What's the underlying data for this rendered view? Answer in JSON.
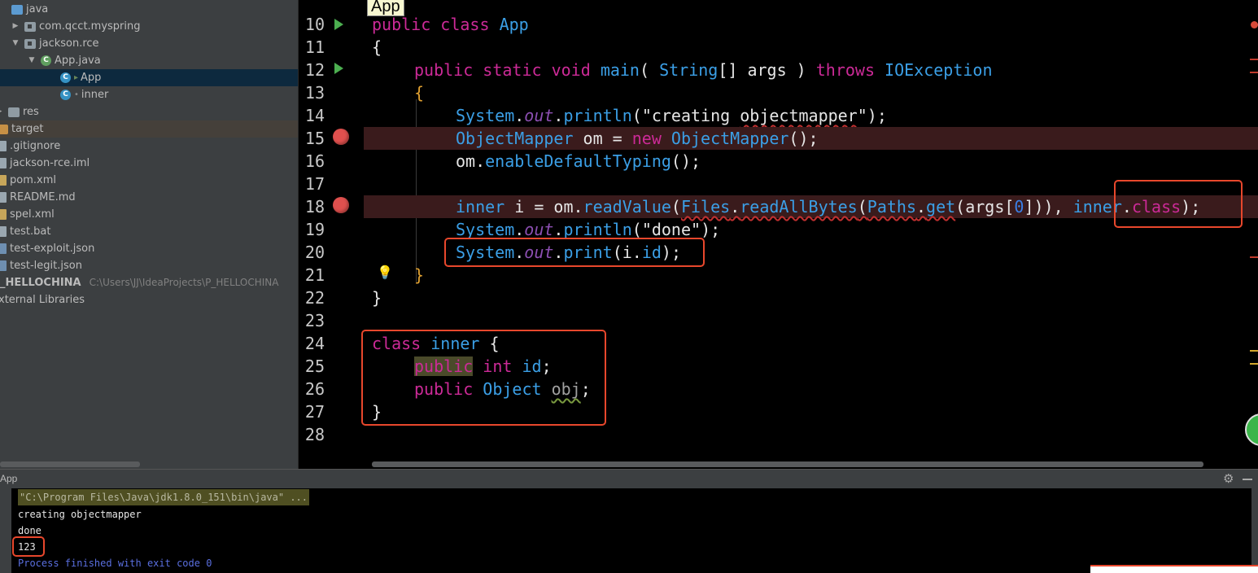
{
  "project_tree": [
    {
      "label": "java",
      "icon": "folder-blue-icon",
      "indent": 0
    },
    {
      "label": "com.qcct.myspring",
      "icon": "package-icon",
      "arrow": "▶"
    },
    {
      "label": "jackson.rce",
      "icon": "package-icon",
      "arrow": "▼"
    },
    {
      "label": "App.java",
      "icon": "java-file-icon",
      "arrow": "▼"
    },
    {
      "label": "App",
      "icon": "class-icon",
      "selected": true
    },
    {
      "label": "inner",
      "icon": "class-icon"
    },
    {
      "label": "res",
      "icon": "folder-icon",
      "arrow": "▶"
    },
    {
      "label": "target",
      "icon": "folder-orange-icon"
    },
    {
      "label": ".gitignore",
      "icon": "file-icon"
    },
    {
      "label": "jackson-rce.iml",
      "icon": "file-icon"
    },
    {
      "label": "pom.xml",
      "icon": "xml-file-icon"
    },
    {
      "label": "README.md",
      "icon": "file-icon"
    },
    {
      "label": "spel.xml",
      "icon": "xml-file-icon"
    },
    {
      "label": "test.bat",
      "icon": "file-icon"
    },
    {
      "label": "test-exploit.json",
      "icon": "json-file-icon"
    },
    {
      "label": "test-legit.json",
      "icon": "json-file-icon"
    },
    {
      "label": "_HELLOCHINA",
      "path": "C:\\Users\\JJ\\IdeaProjects\\P_HELLOCHINA",
      "icon": "project-icon"
    },
    {
      "label": "xternal Libraries",
      "icon": "library-icon"
    }
  ],
  "editor": {
    "tooltip": "App",
    "line_numbers": [
      "10",
      "11",
      "12",
      "13",
      "14",
      "15",
      "16",
      "17",
      "18",
      "19",
      "20",
      "21",
      "22",
      "23",
      "24",
      "25",
      "26",
      "27",
      "28"
    ],
    "code": {
      "l10": {
        "kw1": "public",
        "kw2": "class",
        "name": "App"
      },
      "l11": "{",
      "l12": {
        "kw1": "public",
        "kw2": "static",
        "kw3": "void",
        "fn": "main",
        "p1": "( ",
        "ty1": "String",
        "p2": "[] args ) ",
        "kw4": "throws",
        "ty2": "IOException"
      },
      "l13": "{",
      "l14": {
        "sys": "System",
        "dot1": ".",
        "out": "out",
        "dot2": ".",
        "fn": "println",
        "p1": "(",
        "str1": "\"creating ",
        "str2": "objectmapper",
        "str3": "\"",
        "p2": ");"
      },
      "l15": {
        "ty1": "ObjectMapper",
        "p1": " om = ",
        "kw": "new",
        "p2": " ",
        "ty2": "ObjectMapper",
        "p3": "();"
      },
      "l16": {
        "p1": "om.",
        "fn": "enableDefaultTyping",
        "p2": "();"
      },
      "l18": {
        "ty1": "inner",
        "p1": " i = om.",
        "fn1": "readValue",
        "p2": "(",
        "ty2": "Files",
        "dot1": ".",
        "fn2": "readAllBytes",
        "p3": "(",
        "ty3": "Paths",
        "dot2": ".",
        "fn3": "get",
        "p4": "(args[",
        "num": "0",
        "p5": "])), ",
        "ty4": "inner",
        "dot3": ".",
        "kw": "class",
        "p6": ");"
      },
      "l19": {
        "sys": "System",
        "dot1": ".",
        "out": "out",
        "dot2": ".",
        "fn": "println",
        "p1": "(",
        "str": "\"done\"",
        "p2": ");"
      },
      "l20": {
        "sys": "System",
        "dot1": ".",
        "out": "out",
        "dot2": ".",
        "fn": "print",
        "p1": "(i.",
        "fld": "id",
        "p2": ");"
      },
      "l21": "}",
      "l22": "}",
      "l24": {
        "kw": "class",
        "name": "inner",
        "brace": " {"
      },
      "l25": {
        "kw1": "public",
        "kw2": "int",
        "fld": "id",
        "semi": ";"
      },
      "l26": {
        "kw": "public",
        "ty": "Object",
        "fld": "obj",
        "semi": ";"
      },
      "l27": "}"
    }
  },
  "run_panel": {
    "title": "App",
    "console": {
      "command": "\"C:\\Program Files\\Java\\jdk1.8.0_151\\bin\\java\" ...",
      "line1": "creating objectmapper",
      "line2": "done",
      "line3": "123",
      "exit": "Process finished with exit code 0"
    }
  },
  "colors": {
    "keyword": "#cc2a97",
    "type": "#3b9fe6",
    "highlight_box": "#e8472c",
    "breakpoint": "#e0504e"
  }
}
